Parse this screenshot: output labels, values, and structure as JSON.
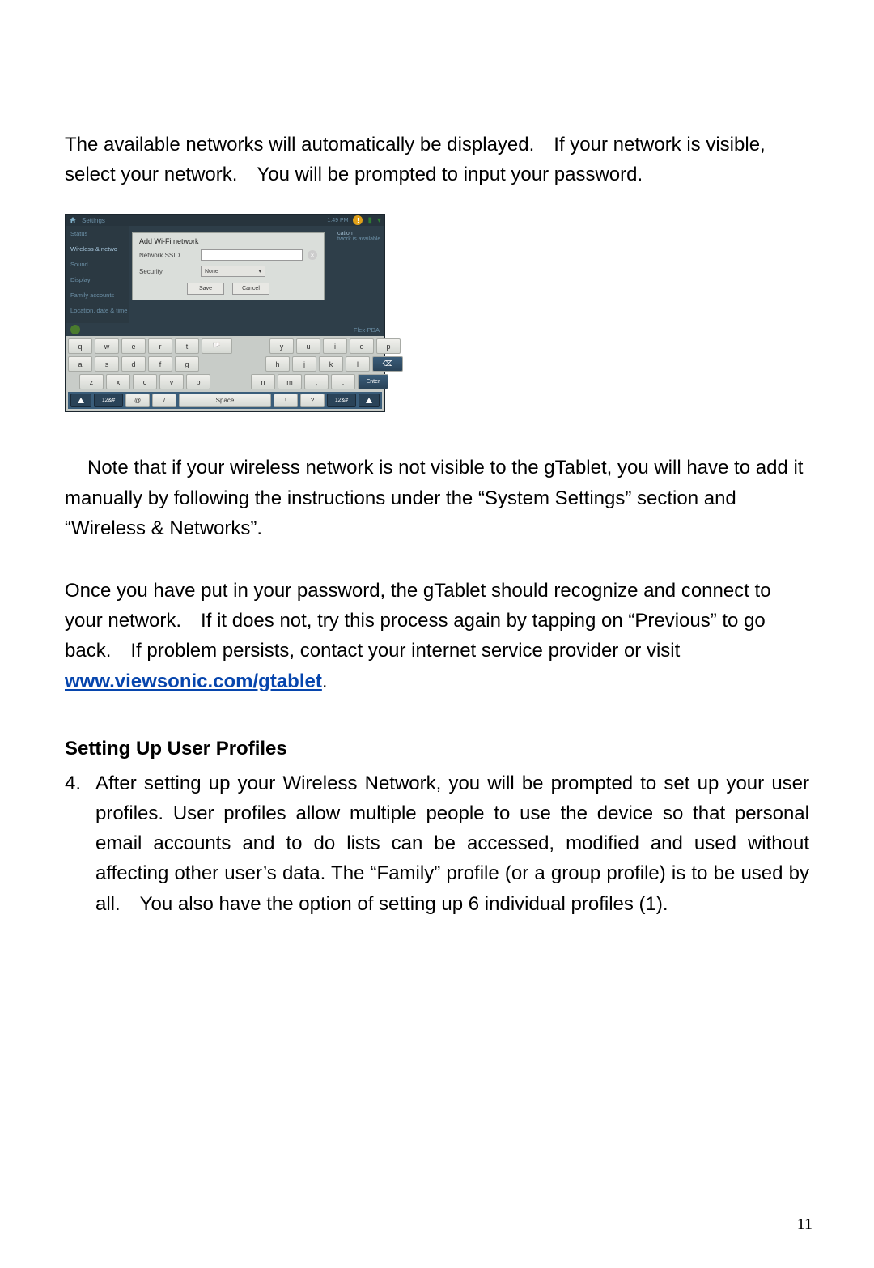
{
  "paragraph1": "The available networks will automatically be displayed. If your network is visible, select your network. You will be prompted to input your password.",
  "screenshot": {
    "topbar": {
      "settings": "Settings",
      "time": "1:49 PM"
    },
    "sidebar": {
      "status": "Status",
      "wireless": "Wireless & netwo",
      "sound": "Sound",
      "display": "Display",
      "family": "Family accounts",
      "location": "Location, date & time"
    },
    "dialog": {
      "title": "Add Wi-Fi network",
      "ssid_label": "Network SSID",
      "security_label": "Security",
      "security_value": "None",
      "save": "Save",
      "cancel": "Cancel"
    },
    "right_panel": {
      "cation": "cation",
      "avail": "twork is available"
    },
    "bottom_strip": {
      "flexpda": "Flex-PDA"
    },
    "keyboard": {
      "row1": [
        "q",
        "w",
        "e",
        "r",
        "t",
        "",
        "y",
        "u",
        "i",
        "o",
        "p"
      ],
      "row2": [
        "a",
        "s",
        "d",
        "f",
        "g",
        "",
        "h",
        "j",
        "k",
        "l",
        ""
      ],
      "row3": [
        "z",
        "x",
        "c",
        "v",
        "b",
        "",
        "n",
        "m",
        ",",
        ".",
        "Enter"
      ],
      "bottom": {
        "num": "12&#",
        "at": "@",
        "slash": "/",
        "space": "Space",
        "excl": "!",
        "qm": "?",
        "num2": "12&#"
      }
    }
  },
  "paragraph2": "Note that if your wireless network is not visible to the gTablet, you will have to add it manually by following the instructions under the “System Settings” section and “Wireless & Networks”.",
  "paragraph3_a": "Once you have put in your password, the gTablet should recognize and connect to your network. If it does not, try this process again by tapping on “Previous” to go back. If problem persists, contact your internet service provider or visit ",
  "paragraph3_link": "www.viewsonic.com/gtablet",
  "paragraph3_b": ".",
  "heading": "Setting Up User Profiles",
  "list_num": "4.",
  "list_text": "After setting up your Wireless Network, you will be prompted to set up your user profiles.  User profiles allow multiple people to use the device so that personal email accounts and to do lists can be accessed, modified and used without affecting other user’s data.  The “Family” profile (or a group profile) is to be used by all. You also have the option of setting up 6 individual profiles (1).",
  "page_number": "11"
}
